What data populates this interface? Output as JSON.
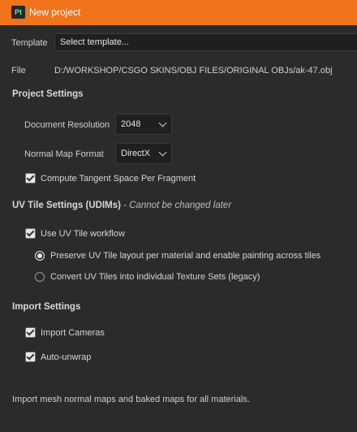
{
  "window": {
    "title": "New project",
    "app_icon_text": "Pt"
  },
  "template": {
    "label": "Template",
    "value": "Select template..."
  },
  "file": {
    "label": "File",
    "path": "D:/WORKSHOP/CSGO SKINS/OBJ FILES/ORIGINAL OBJs/ak-47.obj"
  },
  "project_settings": {
    "title": "Project Settings",
    "resolution_label": "Document Resolution",
    "resolution_value": "2048",
    "normal_map_label": "Normal Map Format",
    "normal_map_value": "DirectX",
    "tangent_label": "Compute Tangent Space Per Fragment"
  },
  "uv_settings": {
    "title": "UV Tile Settings (UDIMs)",
    "note": " - Cannot be changed later",
    "workflow_label": "Use UV Tile workflow",
    "option_preserve": "Preserve UV Tile layout per material and enable painting across tiles",
    "option_convert": "Convert UV Tiles into individual Texture Sets (legacy)"
  },
  "import_settings": {
    "title": "Import Settings",
    "cameras_label": "Import Cameras",
    "unwrap_label": "Auto-unwrap"
  },
  "footer": {
    "text": "Import mesh normal maps and baked maps for all materials."
  }
}
